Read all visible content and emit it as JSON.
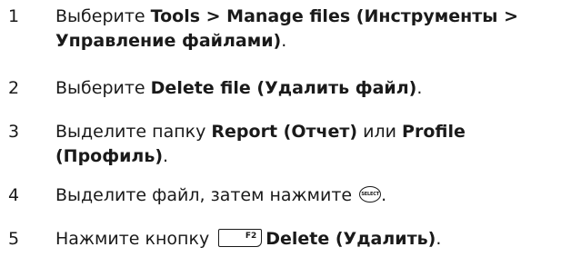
{
  "steps": [
    {
      "num": "1",
      "lead": "Выберите ",
      "bold": "Tools > Manage files (Инструменты > Управление файлами)",
      "tail": "."
    },
    {
      "num": "2",
      "lead": "Выберите ",
      "bold": "Delete file (Удалить файл)",
      "tail": "."
    },
    {
      "num": "3",
      "lead": "Выделите папку ",
      "bold": "Report (Отчет)",
      "mid": " или ",
      "bold2": "Profile (Профиль)",
      "tail": "."
    },
    {
      "num": "4",
      "lead": "Выделите файл, затем нажмите ",
      "button_label": "SELECT",
      "tail": "."
    },
    {
      "num": "5",
      "lead": "Нажмите кнопку ",
      "key_label": "F2",
      "bold": "Delete (Удалить)",
      "tail": "."
    }
  ],
  "icons": {
    "select_button": "select-button-icon",
    "softkey": "softkey-icon"
  }
}
